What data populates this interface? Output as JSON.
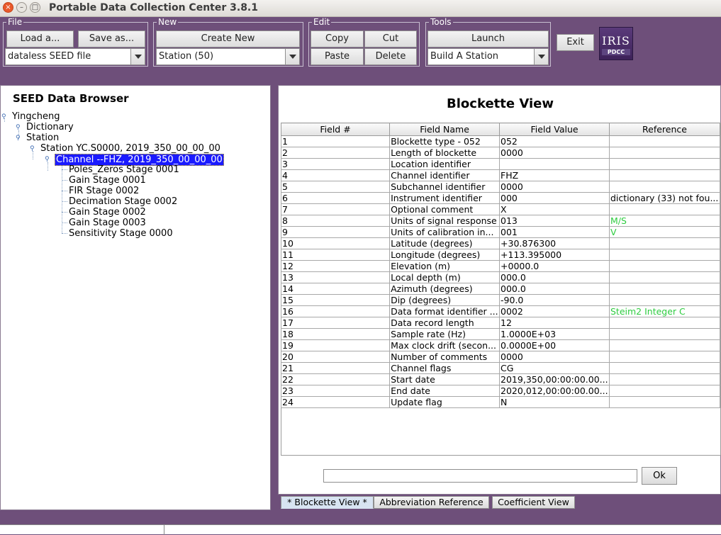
{
  "window": {
    "title": "Portable Data Collection Center 3.8.1"
  },
  "groups": {
    "file": {
      "label": "File",
      "load": "Load a...",
      "save": "Save as...",
      "combo": "dataless SEED file"
    },
    "new": {
      "label": "New",
      "create": "Create New",
      "combo": "Station (50)"
    },
    "edit": {
      "label": "Edit",
      "copy": "Copy",
      "cut": "Cut",
      "paste": "Paste",
      "delete": "Delete"
    },
    "tools": {
      "label": "Tools",
      "launch": "Launch",
      "combo": "Build A Station"
    },
    "exit": "Exit"
  },
  "logo": {
    "text": "IRIS",
    "sub": "PDCC"
  },
  "browser": {
    "title": "SEED Data Browser",
    "nodes": [
      "Yingcheng",
      "Dictionary",
      "Station",
      "Station YC.S0000, 2019_350_00_00_00",
      "Channel --FHZ, 2019_350_00_00_00",
      "Poles_Zeros Stage 0001",
      "Gain Stage 0001",
      "FIR Stage 0002",
      "Decimation Stage 0002",
      "Gain Stage 0002",
      "Gain Stage 0003",
      "Sensitivity Stage 0000"
    ]
  },
  "blockette": {
    "title": "Blockette View",
    "headers": [
      "Field #",
      "Field Name",
      "Field Value",
      "Reference"
    ],
    "rows": [
      [
        "1",
        "Blockette type - 052",
        "052",
        ""
      ],
      [
        "2",
        "Length of blockette",
        "0000",
        ""
      ],
      [
        "3",
        "Location identifier",
        "",
        ""
      ],
      [
        "4",
        "Channel identifier",
        "FHZ",
        ""
      ],
      [
        "5",
        "Subchannel identifier",
        "0000",
        ""
      ],
      [
        "6",
        "Instrument identifier",
        "000",
        "dictionary (33) not fou..."
      ],
      [
        "7",
        "Optional comment",
        "X",
        ""
      ],
      [
        "8",
        "Units of signal response",
        "013",
        "M/S"
      ],
      [
        "9",
        "Units of calibration in...",
        "001",
        "V"
      ],
      [
        "10",
        "Latitude (degrees)",
        "+30.876300",
        ""
      ],
      [
        "11",
        "Longitude (degrees)",
        "+113.395000",
        ""
      ],
      [
        "12",
        "Elevation (m)",
        "+0000.0",
        ""
      ],
      [
        "13",
        "Local depth (m)",
        "000.0",
        ""
      ],
      [
        "14",
        "Azimuth (degrees)",
        "000.0",
        ""
      ],
      [
        "15",
        "Dip (degrees)",
        "-90.0",
        ""
      ],
      [
        "16",
        "Data format identifier ...",
        "0002",
        "Steim2 Integer C"
      ],
      [
        "17",
        "Data record length",
        "12",
        ""
      ],
      [
        "18",
        "Sample rate (Hz)",
        "1.0000E+03",
        ""
      ],
      [
        "19",
        "Max clock drift (secon...",
        "0.0000E+00",
        ""
      ],
      [
        "20",
        "Number of comments",
        "0000",
        ""
      ],
      [
        "21",
        "Channel flags",
        "CG",
        ""
      ],
      [
        "22",
        "Start date",
        "2019,350,00:00:00.00...",
        ""
      ],
      [
        "23",
        "End date",
        "2020,012,00:00:00.00...",
        ""
      ],
      [
        "24",
        "Update flag",
        "N",
        ""
      ]
    ],
    "green_refs": [
      7,
      8,
      15
    ],
    "ok_label": "Ok",
    "input_value": ""
  },
  "tabs": [
    "* Blockette View *",
    "Abbreviation Reference",
    "Coefficient View"
  ],
  "colors": {
    "frame": "#6e4f7a",
    "selection": "#1a1aff",
    "reference_green": "#2ecc40"
  }
}
